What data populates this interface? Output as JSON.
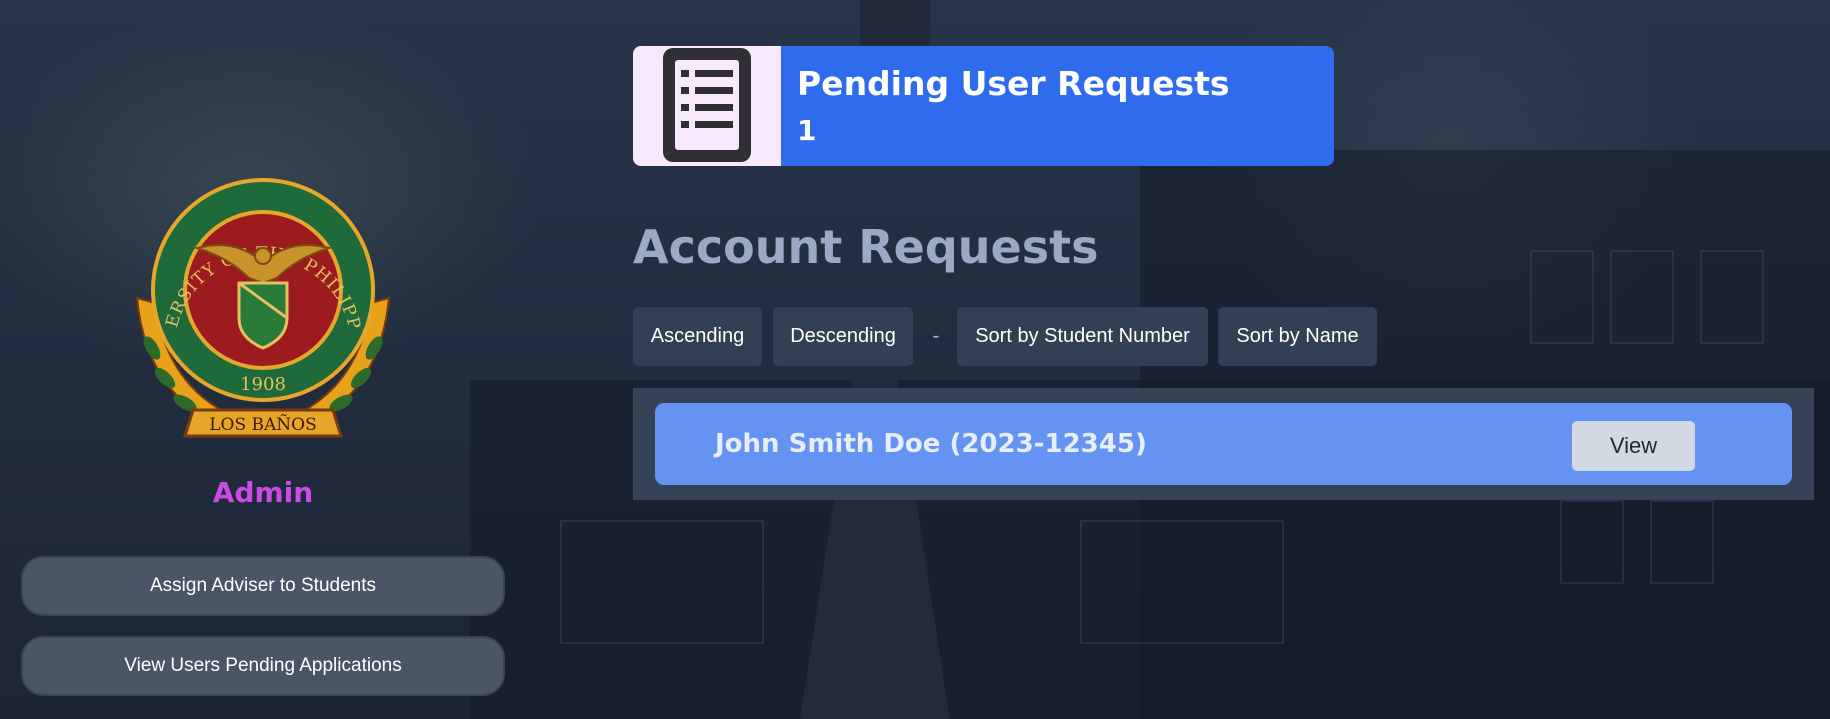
{
  "colors": {
    "accent_blue": "#2f6bed",
    "row_blue": "#6493f4",
    "role_purple": "#cc4ae6",
    "button_gray": "#4a5567"
  },
  "sidebar": {
    "logo": {
      "icon": "university-of-the-philippines-seal",
      "text_top": "UNIVERSITY OF THE PHILIPPINES",
      "year": "1908",
      "banner": "LOS BAÑOS"
    },
    "role": "Admin",
    "buttons": [
      {
        "label": "Assign Adviser to Students"
      },
      {
        "label": "View Users Pending Applications"
      }
    ]
  },
  "stat_card": {
    "icon": "list-document-icon",
    "label": "Pending User Requests",
    "value": "1"
  },
  "main": {
    "title": "Account Requests",
    "sort": {
      "ascending": "Ascending",
      "descending": "Descending",
      "separator": "-",
      "by_student_number": "Sort by Student Number",
      "by_name": "Sort by Name"
    },
    "requests": [
      {
        "name": "John Smith Doe (2023-12345)",
        "action": "View"
      }
    ]
  }
}
